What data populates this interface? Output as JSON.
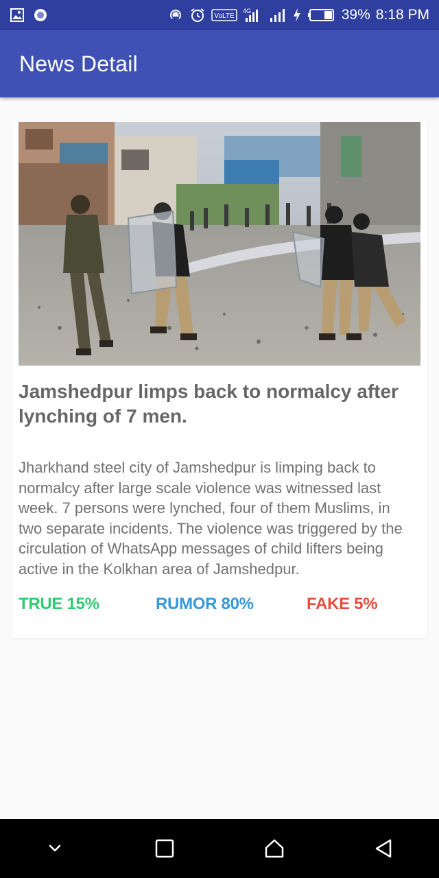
{
  "status_bar": {
    "battery": "39%",
    "time": "8:18 PM",
    "volte": "VoLTE",
    "network": "4G"
  },
  "app_bar": {
    "title": "News Detail"
  },
  "article": {
    "headline": "Jamshedpur limps back to normalcy after lynching of 7 men.",
    "body": "Jharkhand steel city of Jamshedpur is limping back to normalcy after large scale violence was witnessed last week. 7 persons were lynched, four of them Muslims, in two separate incidents. The violence was triggered by the circulation of WhatsApp messages of child lifters being active in the Kolkhan area of Jamshedpur.",
    "image_icon": "news-photo"
  },
  "verdicts": {
    "true_label": "TRUE 15%",
    "rumor_label": "RUMOR 80%",
    "fake_label": "FAKE 5%",
    "colors": {
      "true": "#2ecc71",
      "rumor": "#3498db",
      "fake": "#e74c3c"
    }
  },
  "colors": {
    "status_bar": "#2f3fa0",
    "app_bar": "#3f51b5"
  },
  "nav": {
    "icons": [
      "chevron-down-icon",
      "recents-icon",
      "home-icon",
      "back-icon"
    ]
  }
}
